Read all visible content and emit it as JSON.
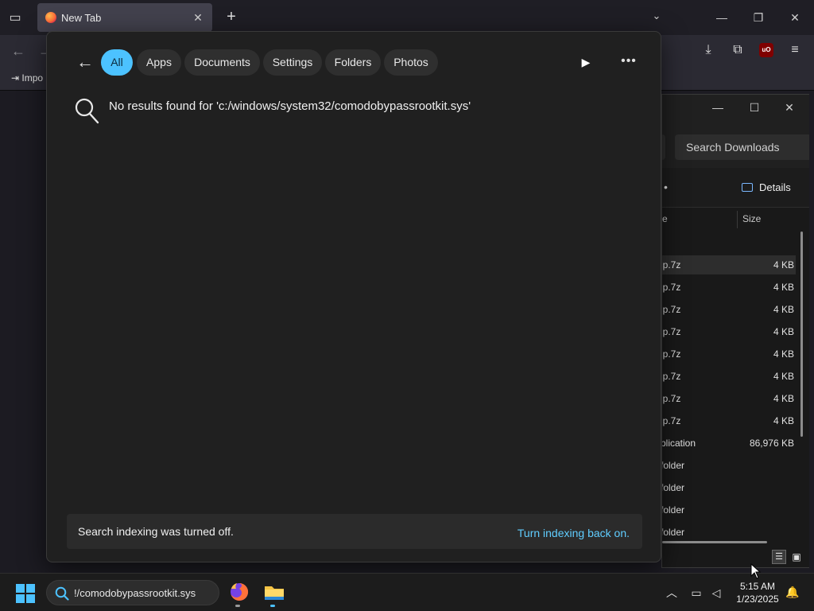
{
  "browser": {
    "tab_title": "New Tab",
    "bookmark_import_label": "Impo"
  },
  "explorer": {
    "search_placeholder": "Search Downloads",
    "details_label": "Details",
    "columns": {
      "name": "e",
      "size": "Size"
    },
    "rows": [
      {
        "name": "ip.7z",
        "size": "4 KB",
        "selected": true
      },
      {
        "name": "ip.7z",
        "size": "4 KB"
      },
      {
        "name": "ip.7z",
        "size": "4 KB"
      },
      {
        "name": "ip.7z",
        "size": "4 KB"
      },
      {
        "name": "ip.7z",
        "size": "4 KB"
      },
      {
        "name": "ip.7z",
        "size": "4 KB"
      },
      {
        "name": "ip.7z",
        "size": "4 KB"
      },
      {
        "name": "ip.7z",
        "size": "4 KB"
      },
      {
        "name": "plication",
        "size": "86,976 KB"
      },
      {
        "name": "folder",
        "size": ""
      },
      {
        "name": "folder",
        "size": ""
      },
      {
        "name": "folder",
        "size": ""
      },
      {
        "name": "folder",
        "size": ""
      }
    ]
  },
  "search_flyout": {
    "filters": [
      "All",
      "Apps",
      "Documents",
      "Settings",
      "Folders",
      "Photos"
    ],
    "active_filter": "All",
    "no_results_text": "No results found for 'c:/windows/system32/comodobypassrootkit.sys'",
    "banner_text": "Search indexing was turned off.",
    "banner_link": "Turn indexing back on."
  },
  "taskbar": {
    "search_text": "!/comodobypassrootkit.sys",
    "time": "5:15 AM",
    "date": "1/23/2025"
  },
  "colors": {
    "accent": "#4cc2ff",
    "link": "#60cdff",
    "flyout_bg": "#202020"
  }
}
